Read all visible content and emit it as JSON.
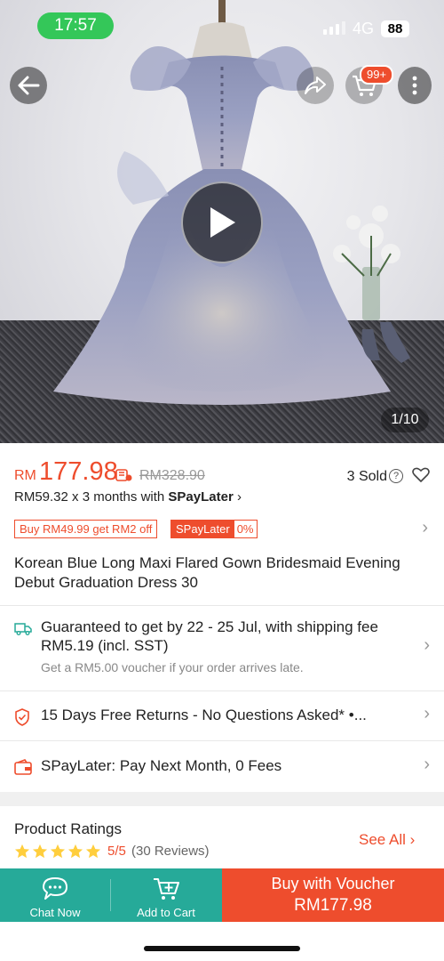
{
  "status_bar": {
    "time": "17:57",
    "network": "4G",
    "battery": "88"
  },
  "header": {
    "cart_badge": "99+",
    "image_counter": "1/10"
  },
  "price": {
    "currency": "RM",
    "current": "177.98",
    "original": "RM328.90",
    "sold": "3 Sold",
    "installment_prefix": "RM59.32 x 3 months with ",
    "installment_brand": "SPayLater",
    "installment_arrow": "›"
  },
  "promos": {
    "voucher": "Buy RM49.99 get RM2 off",
    "spaylater_label": "SPayLater",
    "spaylater_rate": "0%"
  },
  "product": {
    "title": "Korean Blue Long Maxi Flared Gown Bridesmaid Evening Debut Graduation Dress 30"
  },
  "shipping": {
    "main": "Guaranteed to get by 22 - 25 Jul, with shipping fee RM5.19 (incl. SST)",
    "sub": "Get a RM5.00 voucher if your order arrives late."
  },
  "returns": {
    "text": "15 Days Free Returns - No Questions Asked*  •..."
  },
  "spaylater_row": {
    "text": "SPayLater: Pay Next Month, 0 Fees"
  },
  "ratings": {
    "title": "Product Ratings",
    "score": "5/5",
    "count": "(30 Reviews)",
    "stars": 5,
    "see_all": "See All"
  },
  "bottom_bar": {
    "chat": "Chat Now",
    "add_to_cart": "Add to Cart",
    "buy_label": "Buy with Voucher",
    "buy_price": "RM177.98"
  },
  "colors": {
    "brand": "#ee4d2d",
    "teal": "#26aa99"
  },
  "icons": [
    "back-arrow-icon",
    "share-icon",
    "cart-icon",
    "more-icon",
    "play-icon",
    "truck-icon",
    "shield-icon",
    "wallet-icon",
    "chat-icon",
    "add-cart-icon",
    "heart-icon",
    "help-icon",
    "star-icon"
  ]
}
